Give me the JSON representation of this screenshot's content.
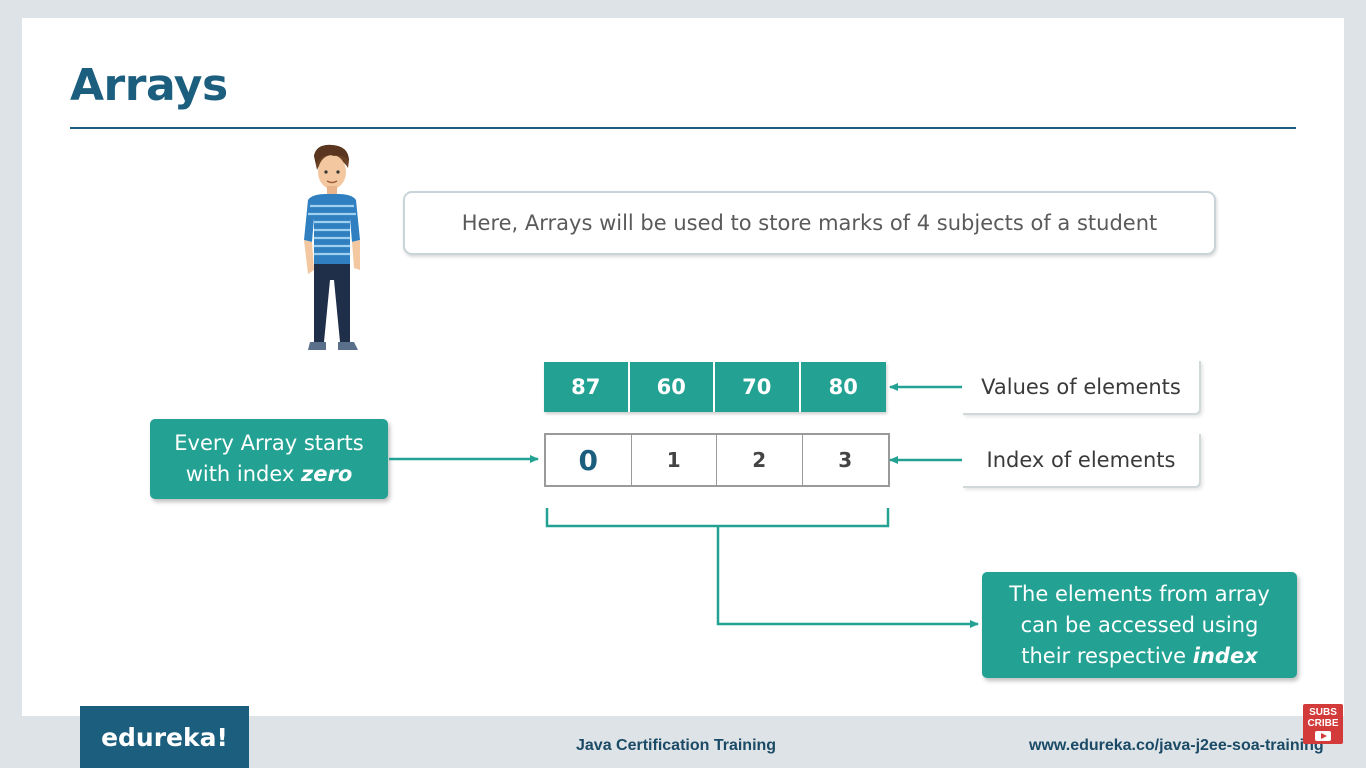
{
  "slide": {
    "title": "Arrays",
    "speech_text": "Here, Arrays will be used to store marks of 4 subjects of a student",
    "values": [
      "87",
      "60",
      "70",
      "80"
    ],
    "indexes": [
      "0",
      "1",
      "2",
      "3"
    ],
    "values_label": "Values of elements",
    "index_label": "Index of elements",
    "left_callout": {
      "line1": "Every Array starts",
      "line2_prefix": "with index ",
      "line2_emphasis": "zero"
    },
    "right_callout": {
      "line1": "The elements from array",
      "line2": "can be accessed using",
      "line3_prefix": "their respective ",
      "line3_emphasis": "index"
    }
  },
  "footer": {
    "logo": "edureka!",
    "course": "Java Certification Training",
    "url": "www.edureka.co/java-j2ee-soa-training",
    "subscribe_line1": "SUBS",
    "subscribe_line2": "CRIBE"
  },
  "colors": {
    "accent": "#23a293",
    "title": "#1b5e7e",
    "background": "#dde3e6"
  },
  "icons": {
    "person": "student-figure-illustration",
    "subscribe": "play-icon"
  }
}
